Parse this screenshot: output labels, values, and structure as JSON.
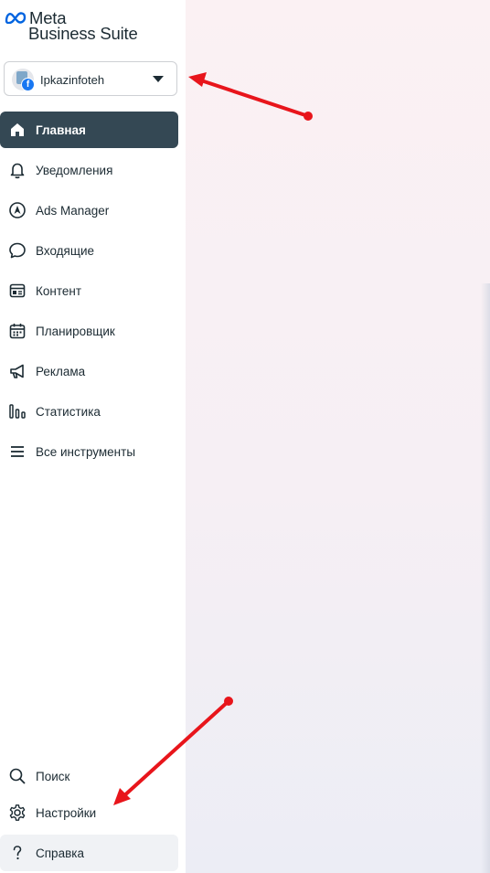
{
  "logo": {
    "line1": "Meta",
    "line2": "Business Suite"
  },
  "account": {
    "name": "Ipkazinfoteh",
    "badge": "f"
  },
  "nav": [
    {
      "label": "Главная",
      "icon": "home-icon",
      "active": true
    },
    {
      "label": "Уведомления",
      "icon": "bell-icon"
    },
    {
      "label": "Ads Manager",
      "icon": "ads-manager-icon"
    },
    {
      "label": "Входящие",
      "icon": "chat-bubble-icon"
    },
    {
      "label": "Контент",
      "icon": "content-icon"
    },
    {
      "label": "Планировщик",
      "icon": "calendar-icon"
    },
    {
      "label": "Реклама",
      "icon": "megaphone-icon"
    },
    {
      "label": "Статистика",
      "icon": "bar-chart-icon"
    },
    {
      "label": "Все инструменты",
      "icon": "menu-icon"
    }
  ],
  "bottom": [
    {
      "label": "Поиск",
      "icon": "search-icon"
    },
    {
      "label": "Настройки",
      "icon": "gear-icon"
    },
    {
      "label": "Справка",
      "icon": "help-icon"
    }
  ],
  "colors": {
    "active_bg": "#344854",
    "annotation": "#e8151b",
    "help_bg": "#f0f2f5"
  }
}
